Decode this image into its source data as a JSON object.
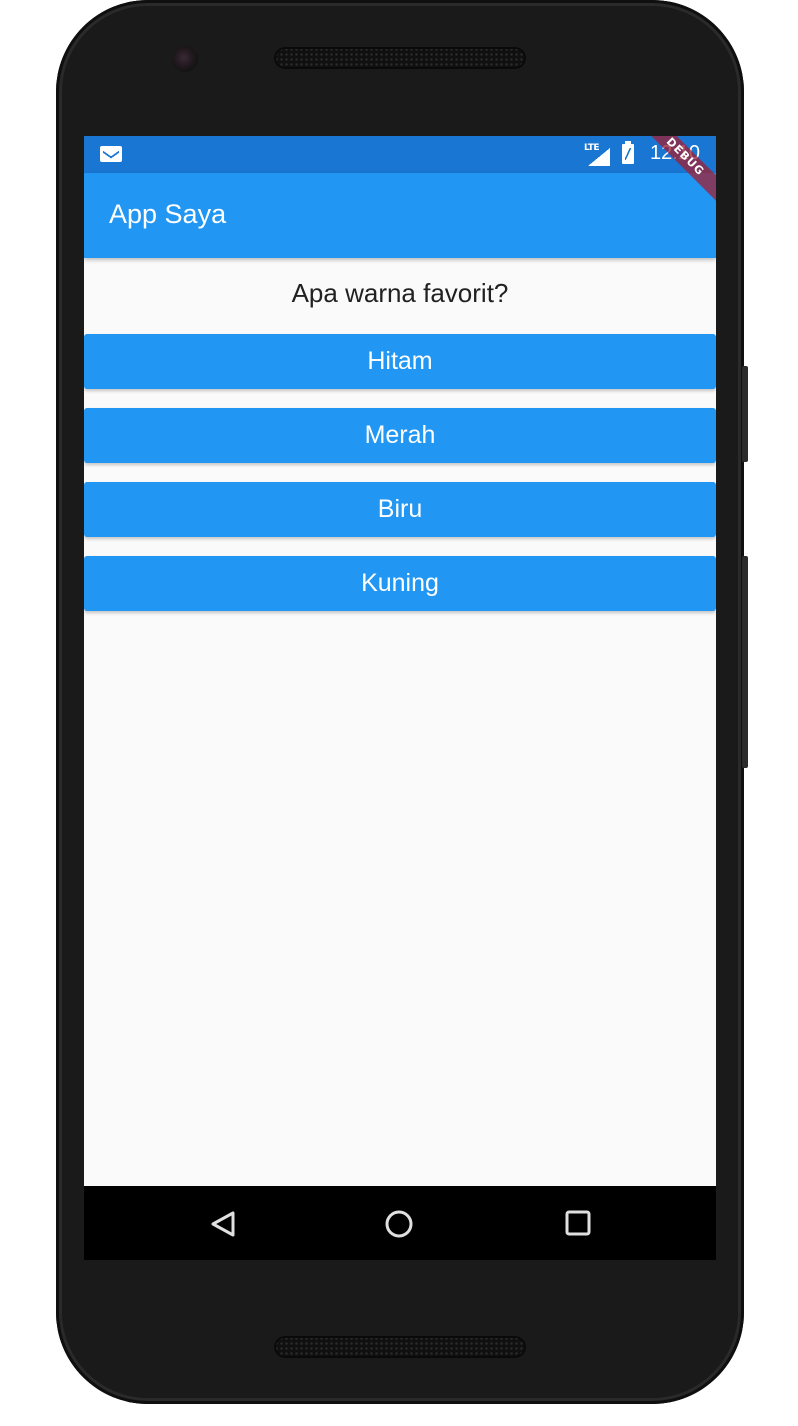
{
  "status_bar": {
    "network_label": "LTE",
    "time": "12:10",
    "debug_label": "DEBUG",
    "color": "#1976d2"
  },
  "app_bar": {
    "title": "App Saya",
    "color": "#2196f3"
  },
  "quiz": {
    "question": "Apa warna favorit?",
    "answers": [
      {
        "label": "Hitam"
      },
      {
        "label": "Merah"
      },
      {
        "label": "Biru"
      },
      {
        "label": "Kuning"
      }
    ]
  },
  "nav_bar": {
    "icons": [
      "back-icon",
      "home-icon",
      "recents-icon"
    ]
  }
}
